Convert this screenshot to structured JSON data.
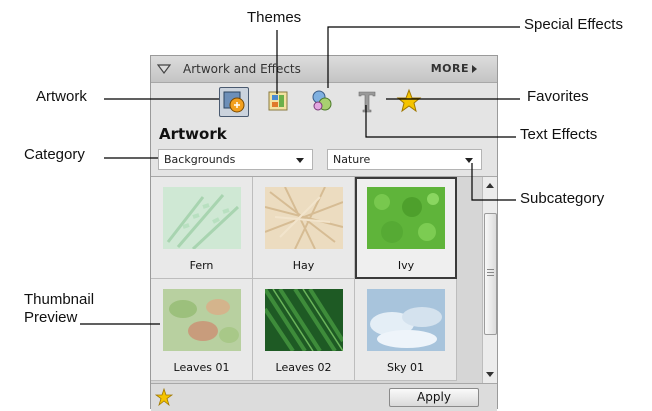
{
  "callouts": {
    "themes": "Themes",
    "special_effects": "Special Effects",
    "artwork": "Artwork",
    "favorites": "Favorites",
    "text_effects": "Text Effects",
    "category": "Category",
    "subcategory": "Subcategory",
    "thumbnail_preview": "Thumbnail Preview"
  },
  "panel": {
    "title": "Artwork and Effects",
    "more_label": "MORE",
    "section_title": "Artwork",
    "tools": [
      {
        "name": "artwork",
        "icon": "artwork-icon",
        "active": true
      },
      {
        "name": "themes",
        "icon": "themes-icon",
        "active": false
      },
      {
        "name": "special-effects",
        "icon": "special-effects-icon",
        "active": false
      },
      {
        "name": "text-effects",
        "icon": "text-effects-icon",
        "active": false
      },
      {
        "name": "favorites",
        "icon": "favorites-star-icon",
        "active": false
      }
    ],
    "category_value": "Backgrounds",
    "subcategory_value": "Nature",
    "thumbnails": [
      {
        "label": "Fern",
        "selected": false
      },
      {
        "label": "Hay",
        "selected": false
      },
      {
        "label": "Ivy",
        "selected": true
      },
      {
        "label": "Leaves 01",
        "selected": false
      },
      {
        "label": "Leaves 02",
        "selected": false
      },
      {
        "label": "Sky 01",
        "selected": false
      }
    ],
    "apply_label": "Apply"
  },
  "colors": {
    "star": "#f5c400",
    "selection_border": "#3a3a3a"
  }
}
